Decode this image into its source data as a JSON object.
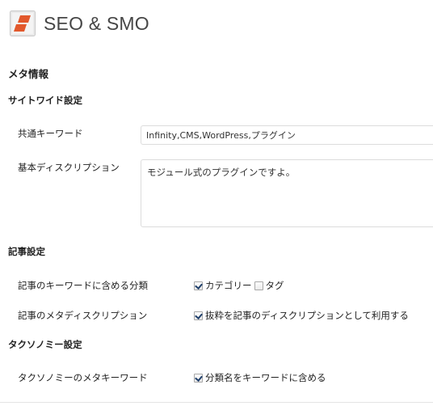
{
  "header": {
    "title": "SEO & SMO",
    "logo_icon": "seo-smo-logo-icon",
    "logo_colors": {
      "square": "#e8e8e8",
      "bars": "#e2582c"
    }
  },
  "sections": {
    "meta": {
      "title": "メタ情報"
    },
    "sitewide": {
      "title": "サイトワイド設定",
      "keywords_label": "共通キーワード",
      "keywords_value": "Infinity,CMS,WordPress,プラグイン",
      "description_label": "基本ディスクリプション",
      "description_value": "モジュール式のプラグインですよ。"
    },
    "article": {
      "title": "記事設定",
      "taxonomy_label": "記事のキーワードに含める分類",
      "category_label": "カテゴリー",
      "category_checked": true,
      "tag_label": "タグ",
      "tag_checked": false,
      "meta_desc_label": "記事のメタディスクリプション",
      "excerpt_label": "抜粋を記事のディスクリプションとして利用する",
      "excerpt_checked": true
    },
    "taxonomy": {
      "title": "タクソノミー設定",
      "meta_keyword_label": "タクソノミーのメタキーワード",
      "include_term_label": "分類名をキーワードに含める",
      "include_term_checked": true
    }
  }
}
